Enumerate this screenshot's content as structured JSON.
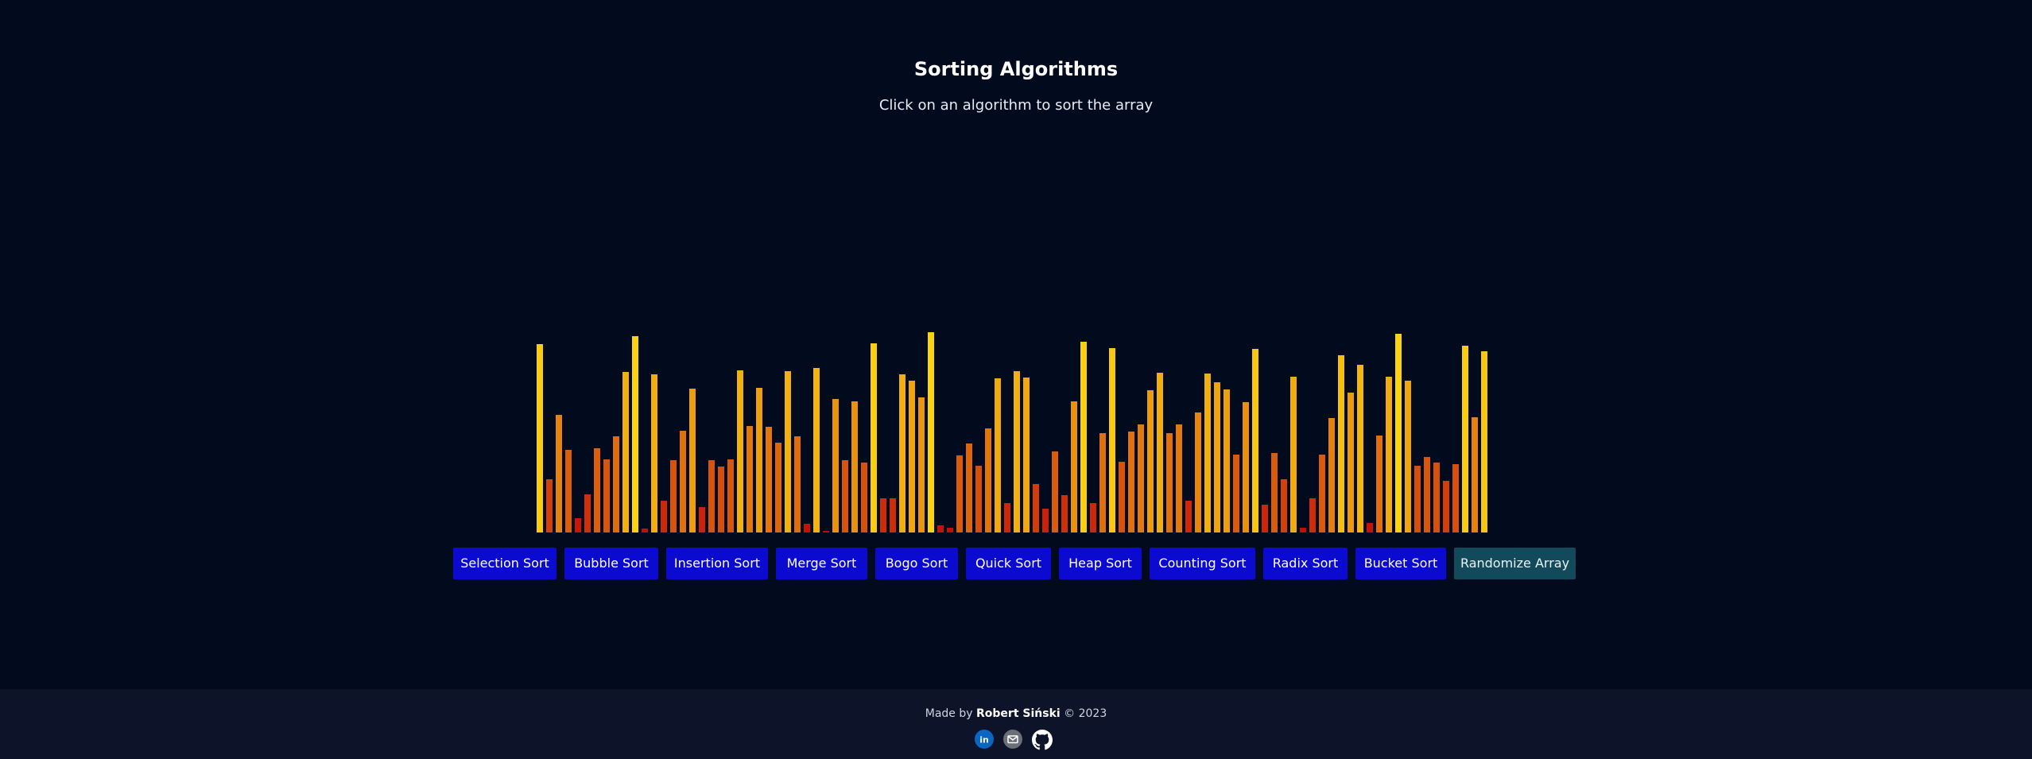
{
  "header": {
    "title": "Sorting Algorithms",
    "subtitle": "Click on an algorithm to sort the array"
  },
  "array": {
    "max_value": 240,
    "values": [
      232,
      66,
      145,
      102,
      18,
      47,
      104,
      90,
      119,
      198,
      242,
      5,
      195,
      39,
      89,
      125,
      177,
      31,
      89,
      81,
      90,
      200,
      131,
      178,
      130,
      111,
      199,
      119,
      11,
      203,
      2,
      165,
      89,
      162,
      86,
      233,
      42,
      42,
      195,
      187,
      167,
      247,
      9,
      6,
      95,
      110,
      82,
      128,
      190,
      36,
      199,
      191,
      60,
      29,
      100,
      46,
      162,
      235,
      36,
      122,
      227,
      87,
      124,
      133,
      175,
      197,
      122,
      133,
      39,
      148,
      196,
      185,
      176,
      96,
      161,
      226,
      34,
      98,
      66,
      192,
      6,
      42,
      96,
      141,
      218,
      172,
      207,
      12,
      120,
      192,
      245,
      187,
      82,
      93,
      86,
      64,
      84,
      230,
      142,
      223
    ],
    "color_low": "#c40808",
    "color_high": "#fbd40e"
  },
  "controls": {
    "buttons": [
      {
        "name": "selection-sort-button",
        "label": "Selection Sort",
        "kind": "sort"
      },
      {
        "name": "bubble-sort-button",
        "label": "Bubble Sort",
        "kind": "sort"
      },
      {
        "name": "insertion-sort-button",
        "label": "Insertion Sort",
        "kind": "sort"
      },
      {
        "name": "merge-sort-button",
        "label": "Merge Sort",
        "kind": "sort"
      },
      {
        "name": "bogo-sort-button",
        "label": "Bogo Sort",
        "kind": "sort"
      },
      {
        "name": "quick-sort-button",
        "label": "Quick Sort",
        "kind": "sort"
      },
      {
        "name": "heap-sort-button",
        "label": "Heap Sort",
        "kind": "sort"
      },
      {
        "name": "counting-sort-button",
        "label": "Counting Sort",
        "kind": "sort"
      },
      {
        "name": "radix-sort-button",
        "label": "Radix Sort",
        "kind": "sort"
      },
      {
        "name": "bucket-sort-button",
        "label": "Bucket Sort",
        "kind": "sort"
      },
      {
        "name": "randomize-array-button",
        "label": "Randomize Array",
        "kind": "randomize"
      }
    ],
    "sort_color": "#0a0ad0",
    "randomize_color": "#124a5c"
  },
  "footer": {
    "made_by": "Made by",
    "author": "Robert Siński",
    "copyright": "© 2023",
    "icons": [
      {
        "name": "linkedin-icon",
        "glyph": "in",
        "color": "#0a66c2"
      },
      {
        "name": "email-icon",
        "glyph": "✉",
        "color": "#6b6f78"
      },
      {
        "name": "github-icon",
        "glyph": "",
        "color": "#ffffff"
      }
    ]
  }
}
